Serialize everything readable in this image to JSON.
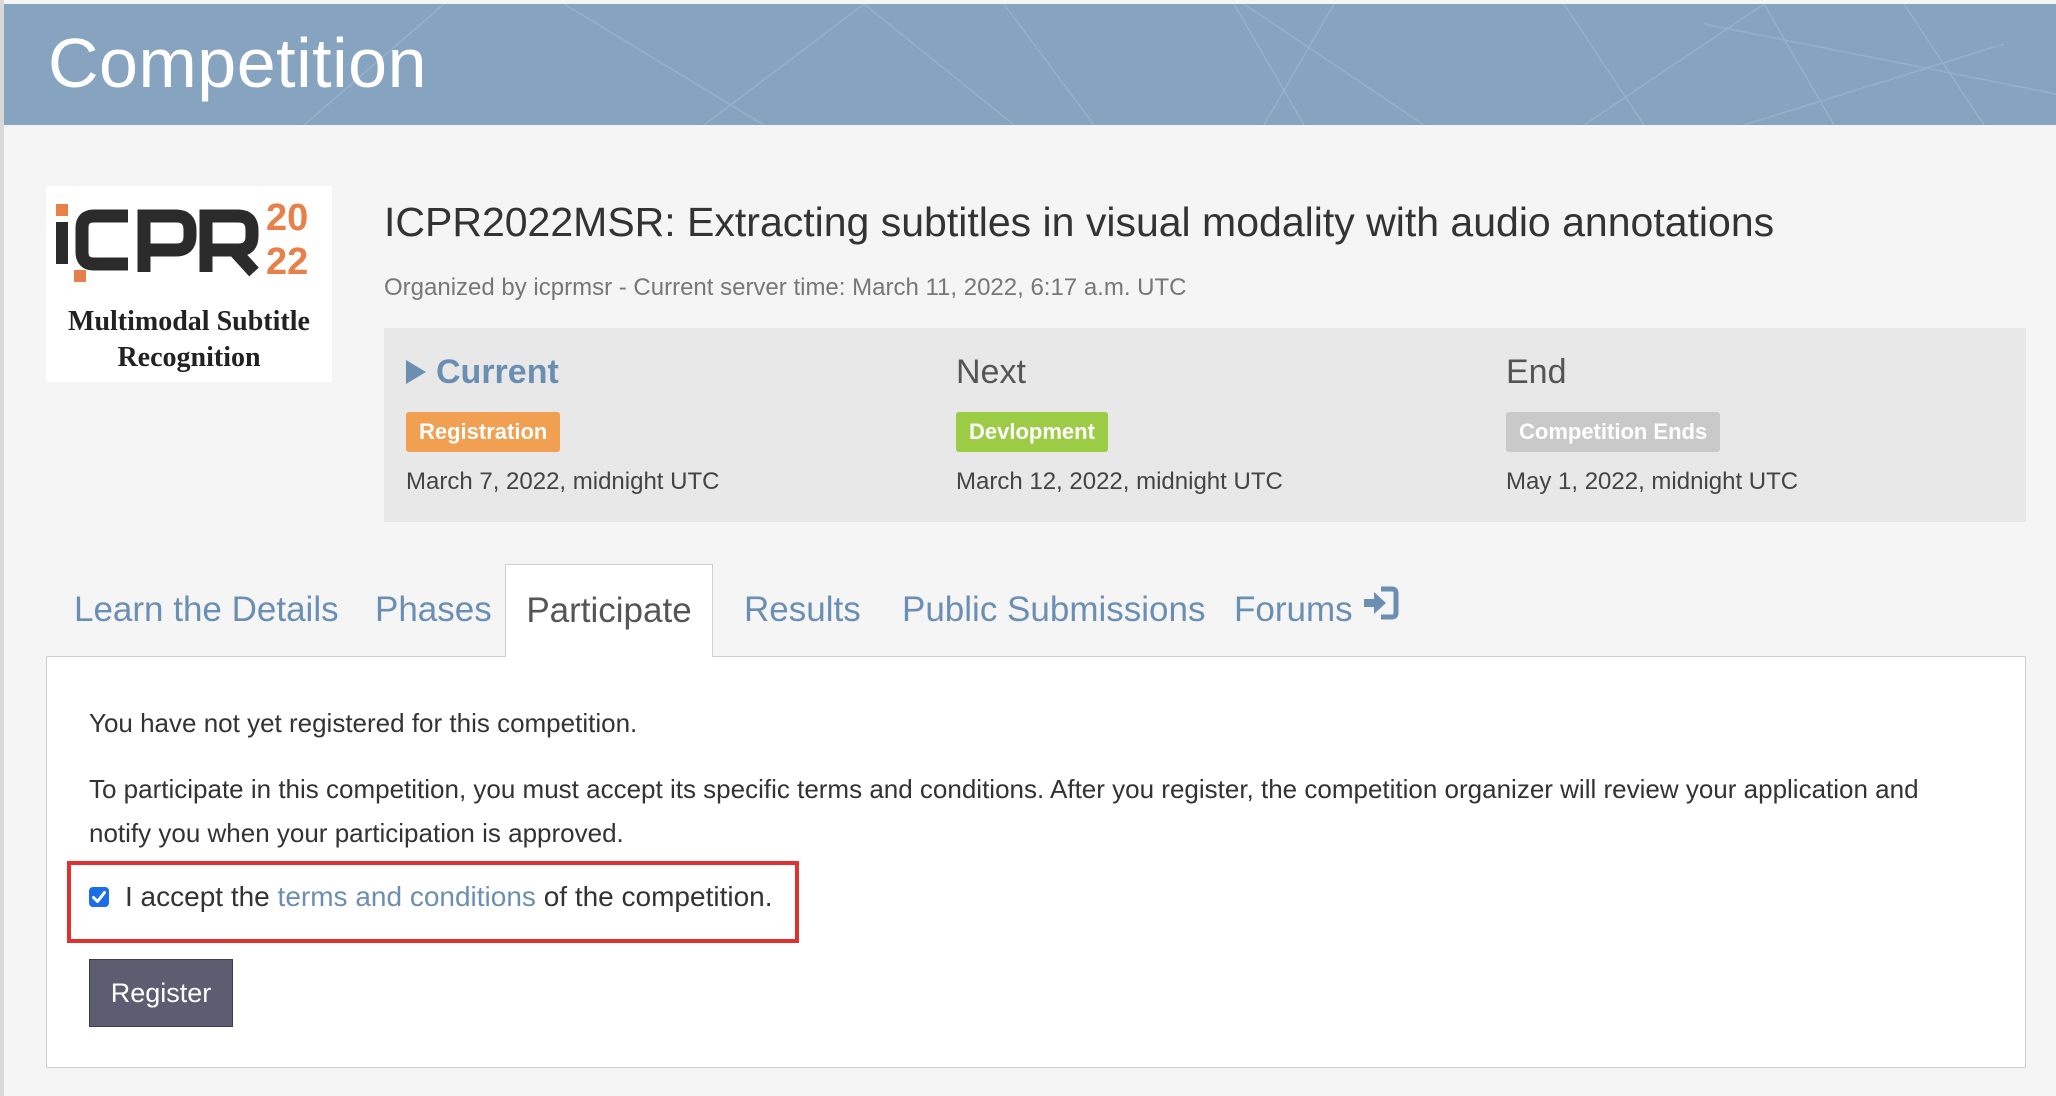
{
  "banner": {
    "title": "Competition"
  },
  "logo": {
    "caption_line1": "Multimodal Subtitle",
    "caption_line2": "Recognition",
    "alt": "ICPR 2022",
    "mark_text": "iCPR",
    "year_top": "20",
    "year_bottom": "22",
    "colors": {
      "dark": "#2b2b2b",
      "orange": "#e8804a"
    }
  },
  "competition": {
    "title": "ICPR2022MSR: Extracting subtitles in visual modality with audio annotations",
    "meta": "Organized by icprmsr - Current server time: March 11, 2022, 6:17 a.m. UTC"
  },
  "phases": [
    {
      "heading": "Current",
      "badge": "Registration",
      "badge_color": "#f0a050",
      "date": "March 7, 2022, midnight UTC"
    },
    {
      "heading": "Next",
      "badge": "Devlopment",
      "badge_color": "#9ccc45",
      "date": "March 12, 2022, midnight UTC"
    },
    {
      "heading": "End",
      "badge": "Competition Ends",
      "badge_color": "#c9c9c9",
      "date": "May 1, 2022, midnight UTC"
    }
  ],
  "tabs": [
    {
      "label": "Learn the Details",
      "active": false
    },
    {
      "label": "Phases",
      "active": false
    },
    {
      "label": "Participate",
      "active": true
    },
    {
      "label": "Results",
      "active": false
    },
    {
      "label": "Public Submissions",
      "active": false
    },
    {
      "label": "Forums",
      "active": false,
      "icon": "sign-in-icon"
    }
  ],
  "participate": {
    "not_registered": "You have not yet registered for this competition.",
    "instructions": "To participate in this competition, you must accept its specific terms and conditions. After you register, the competition organizer will review your application and notify you when your participation is approved.",
    "accept_prefix": "I accept the",
    "terms_link": "terms and conditions",
    "accept_suffix": "of the competition.",
    "accept_checked": true,
    "register_label": "Register"
  },
  "colors": {
    "banner": "#86a3c0",
    "link": "#6b8fb3",
    "highlight": "#e03131",
    "button": "#5d5c71"
  }
}
